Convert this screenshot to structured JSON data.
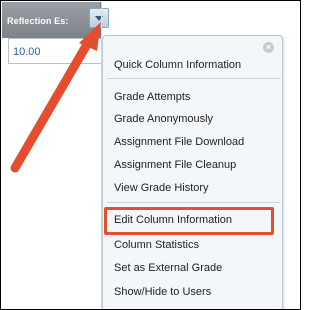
{
  "column": {
    "header_title": "Reflection Es:",
    "cell_value": "10.00"
  },
  "menu": {
    "close_glyph": "×",
    "items": [
      "Quick Column Information",
      "Grade Attempts",
      "Grade Anonymously",
      "Assignment File Download",
      "Assignment File Cleanup",
      "View Grade History",
      "Edit Column Information",
      "Column Statistics",
      "Set as External Grade",
      "Show/Hide to Users"
    ],
    "highlighted_item": "Edit Column Information"
  },
  "colors": {
    "annotation": "#e44d2e",
    "menu_background": "#f3f7fa",
    "cell_text": "#2a5fa3"
  }
}
